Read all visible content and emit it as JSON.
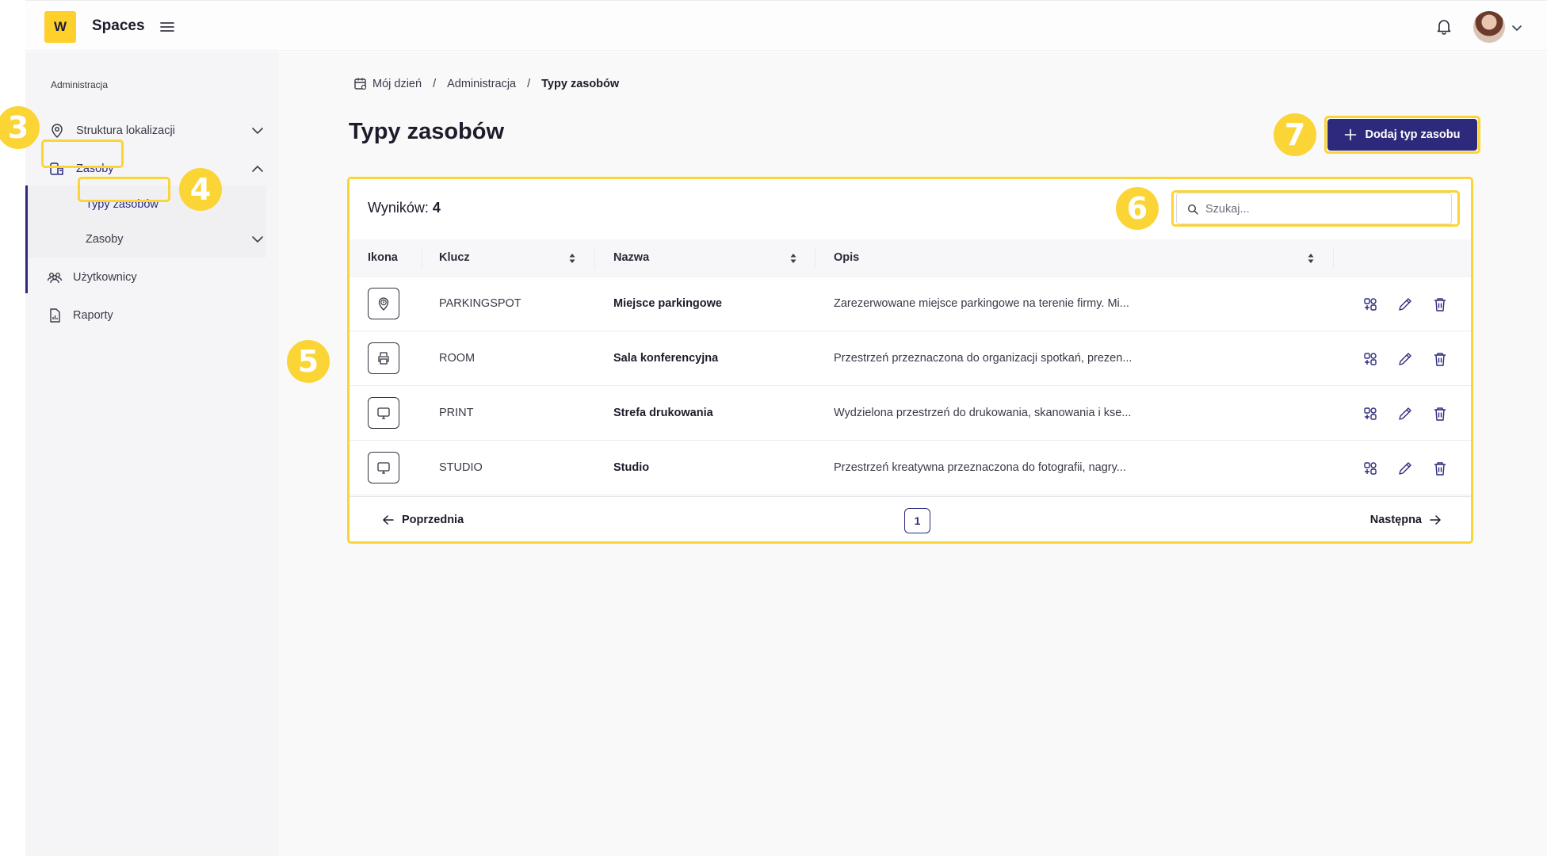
{
  "topbar": {
    "logo_letter": "W",
    "app_name": "Spaces",
    "menu_icon": "hamburger-icon",
    "notifications_icon": "bell-icon",
    "avatar_icon": "user-avatar"
  },
  "sidebar": {
    "section_label": "Administracja",
    "items": [
      {
        "label": "Struktura lokalizacji",
        "icon": "location-pin-icon",
        "expanded": false
      },
      {
        "label": "Zasoby",
        "icon": "resource-icon",
        "expanded": true,
        "active": true
      },
      {
        "label": "Typy zasobów",
        "sub": true,
        "active": true
      },
      {
        "label": "Zasoby",
        "sub": true,
        "expanded": false
      },
      {
        "label": "Użytkownicy",
        "icon": "users-icon"
      },
      {
        "label": "Raporty",
        "icon": "report-icon"
      }
    ]
  },
  "breadcrumb": {
    "items": [
      "Mój dzień",
      "Administracja",
      "Typy zasobów"
    ],
    "separator": "/"
  },
  "page": {
    "title": "Typy zasobów",
    "add_button_label": "Dodaj typ zasobu"
  },
  "table": {
    "results_label": "Wyników:",
    "results_count": "4",
    "search_placeholder": "Szukaj...",
    "columns": [
      "Ikona",
      "Klucz",
      "Nazwa",
      "Opis"
    ],
    "rows": [
      {
        "icon": "parking-pin-icon",
        "key": "PARKINGSPOT",
        "name": "Miejsce parkingowe",
        "description": "Zarezerwowane miejsce parkingowe na terenie firmy. Mi..."
      },
      {
        "icon": "printer-icon",
        "key": "ROOM",
        "name": "Sala konferencyjna",
        "description": "Przestrzeń przeznaczona do organizacji spotkań, prezen..."
      },
      {
        "icon": "monitor-icon",
        "key": "PRINT",
        "name": "Strefa drukowania",
        "description": "Wydzielona przestrzeń do drukowania, skanowania i kse..."
      },
      {
        "icon": "monitor-icon",
        "key": "STUDIO",
        "name": "Studio",
        "description": "Przestrzeń kreatywna przeznaczona do fotografii, nagry..."
      }
    ],
    "row_actions": [
      "attributes-icon",
      "edit-icon",
      "delete-icon"
    ]
  },
  "pagination": {
    "prev_label": "Poprzednia",
    "next_label": "Następna",
    "current_page": "1"
  },
  "annotations": {
    "badges": [
      "3",
      "4",
      "5",
      "6",
      "7"
    ],
    "highlight_color": "#fbd435"
  },
  "colors": {
    "accent": "#2d2a7c",
    "logo": "#fdd02b"
  }
}
